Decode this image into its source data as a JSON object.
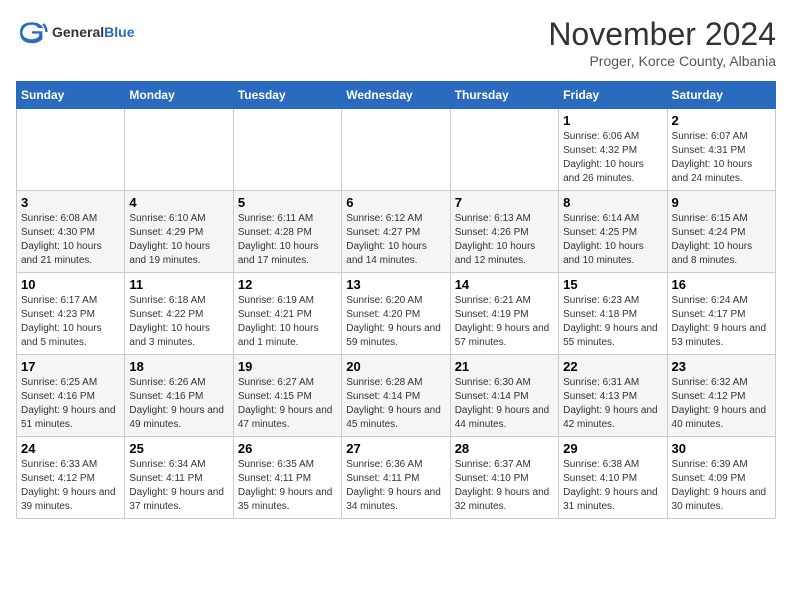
{
  "header": {
    "logo_general": "General",
    "logo_blue": "Blue",
    "month_title": "November 2024",
    "location": "Proger, Korce County, Albania"
  },
  "weekdays": [
    "Sunday",
    "Monday",
    "Tuesday",
    "Wednesday",
    "Thursday",
    "Friday",
    "Saturday"
  ],
  "weeks": [
    [
      {
        "day": "",
        "info": ""
      },
      {
        "day": "",
        "info": ""
      },
      {
        "day": "",
        "info": ""
      },
      {
        "day": "",
        "info": ""
      },
      {
        "day": "",
        "info": ""
      },
      {
        "day": "1",
        "info": "Sunrise: 6:06 AM\nSunset: 4:32 PM\nDaylight: 10 hours and 26 minutes."
      },
      {
        "day": "2",
        "info": "Sunrise: 6:07 AM\nSunset: 4:31 PM\nDaylight: 10 hours and 24 minutes."
      }
    ],
    [
      {
        "day": "3",
        "info": "Sunrise: 6:08 AM\nSunset: 4:30 PM\nDaylight: 10 hours and 21 minutes."
      },
      {
        "day": "4",
        "info": "Sunrise: 6:10 AM\nSunset: 4:29 PM\nDaylight: 10 hours and 19 minutes."
      },
      {
        "day": "5",
        "info": "Sunrise: 6:11 AM\nSunset: 4:28 PM\nDaylight: 10 hours and 17 minutes."
      },
      {
        "day": "6",
        "info": "Sunrise: 6:12 AM\nSunset: 4:27 PM\nDaylight: 10 hours and 14 minutes."
      },
      {
        "day": "7",
        "info": "Sunrise: 6:13 AM\nSunset: 4:26 PM\nDaylight: 10 hours and 12 minutes."
      },
      {
        "day": "8",
        "info": "Sunrise: 6:14 AM\nSunset: 4:25 PM\nDaylight: 10 hours and 10 minutes."
      },
      {
        "day": "9",
        "info": "Sunrise: 6:15 AM\nSunset: 4:24 PM\nDaylight: 10 hours and 8 minutes."
      }
    ],
    [
      {
        "day": "10",
        "info": "Sunrise: 6:17 AM\nSunset: 4:23 PM\nDaylight: 10 hours and 5 minutes."
      },
      {
        "day": "11",
        "info": "Sunrise: 6:18 AM\nSunset: 4:22 PM\nDaylight: 10 hours and 3 minutes."
      },
      {
        "day": "12",
        "info": "Sunrise: 6:19 AM\nSunset: 4:21 PM\nDaylight: 10 hours and 1 minute."
      },
      {
        "day": "13",
        "info": "Sunrise: 6:20 AM\nSunset: 4:20 PM\nDaylight: 9 hours and 59 minutes."
      },
      {
        "day": "14",
        "info": "Sunrise: 6:21 AM\nSunset: 4:19 PM\nDaylight: 9 hours and 57 minutes."
      },
      {
        "day": "15",
        "info": "Sunrise: 6:23 AM\nSunset: 4:18 PM\nDaylight: 9 hours and 55 minutes."
      },
      {
        "day": "16",
        "info": "Sunrise: 6:24 AM\nSunset: 4:17 PM\nDaylight: 9 hours and 53 minutes."
      }
    ],
    [
      {
        "day": "17",
        "info": "Sunrise: 6:25 AM\nSunset: 4:16 PM\nDaylight: 9 hours and 51 minutes."
      },
      {
        "day": "18",
        "info": "Sunrise: 6:26 AM\nSunset: 4:16 PM\nDaylight: 9 hours and 49 minutes."
      },
      {
        "day": "19",
        "info": "Sunrise: 6:27 AM\nSunset: 4:15 PM\nDaylight: 9 hours and 47 minutes."
      },
      {
        "day": "20",
        "info": "Sunrise: 6:28 AM\nSunset: 4:14 PM\nDaylight: 9 hours and 45 minutes."
      },
      {
        "day": "21",
        "info": "Sunrise: 6:30 AM\nSunset: 4:14 PM\nDaylight: 9 hours and 44 minutes."
      },
      {
        "day": "22",
        "info": "Sunrise: 6:31 AM\nSunset: 4:13 PM\nDaylight: 9 hours and 42 minutes."
      },
      {
        "day": "23",
        "info": "Sunrise: 6:32 AM\nSunset: 4:12 PM\nDaylight: 9 hours and 40 minutes."
      }
    ],
    [
      {
        "day": "24",
        "info": "Sunrise: 6:33 AM\nSunset: 4:12 PM\nDaylight: 9 hours and 39 minutes."
      },
      {
        "day": "25",
        "info": "Sunrise: 6:34 AM\nSunset: 4:11 PM\nDaylight: 9 hours and 37 minutes."
      },
      {
        "day": "26",
        "info": "Sunrise: 6:35 AM\nSunset: 4:11 PM\nDaylight: 9 hours and 35 minutes."
      },
      {
        "day": "27",
        "info": "Sunrise: 6:36 AM\nSunset: 4:11 PM\nDaylight: 9 hours and 34 minutes."
      },
      {
        "day": "28",
        "info": "Sunrise: 6:37 AM\nSunset: 4:10 PM\nDaylight: 9 hours and 32 minutes."
      },
      {
        "day": "29",
        "info": "Sunrise: 6:38 AM\nSunset: 4:10 PM\nDaylight: 9 hours and 31 minutes."
      },
      {
        "day": "30",
        "info": "Sunrise: 6:39 AM\nSunset: 4:09 PM\nDaylight: 9 hours and 30 minutes."
      }
    ]
  ]
}
